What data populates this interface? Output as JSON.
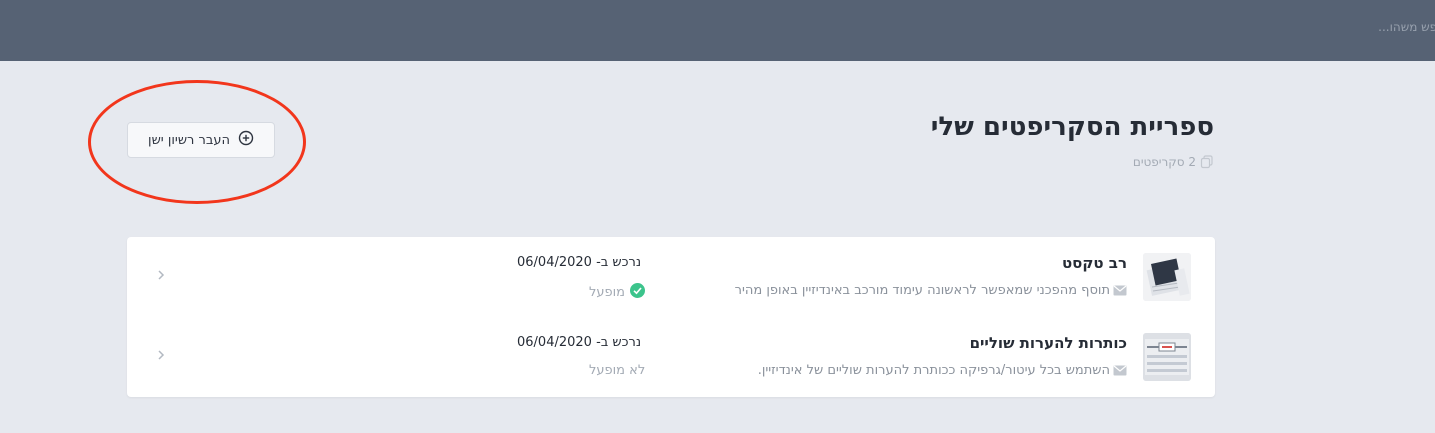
{
  "header": {
    "search_placeholder": "חפש משהו..."
  },
  "page": {
    "title": "ספריית הסקריפטים שלי",
    "count_label": "2 סקריפטים",
    "import_button_label": "העבר רשיון ישן"
  },
  "scripts": [
    {
      "name": "רב טקסט",
      "description": "תוסף מהפכני שמאפשר לראשונה עימוד מורכב באינדיזיין באופן מהיר",
      "purchased": "נרכש ב- 06/04/2020",
      "status": "מופעל",
      "active": true
    },
    {
      "name": "כותרות להערות שוליים",
      "description": "השתמש בכל עיטור/גרפיקה ככותרת להערות שוליים של אינדיזיין.",
      "purchased": "נרכש ב- 06/04/2020",
      "status": "לא מופעל",
      "active": false
    }
  ],
  "colors": {
    "topbar": "#566274",
    "background": "#e6e9ef",
    "active_status": "#3cc48c",
    "annotation": "#f2361c"
  }
}
